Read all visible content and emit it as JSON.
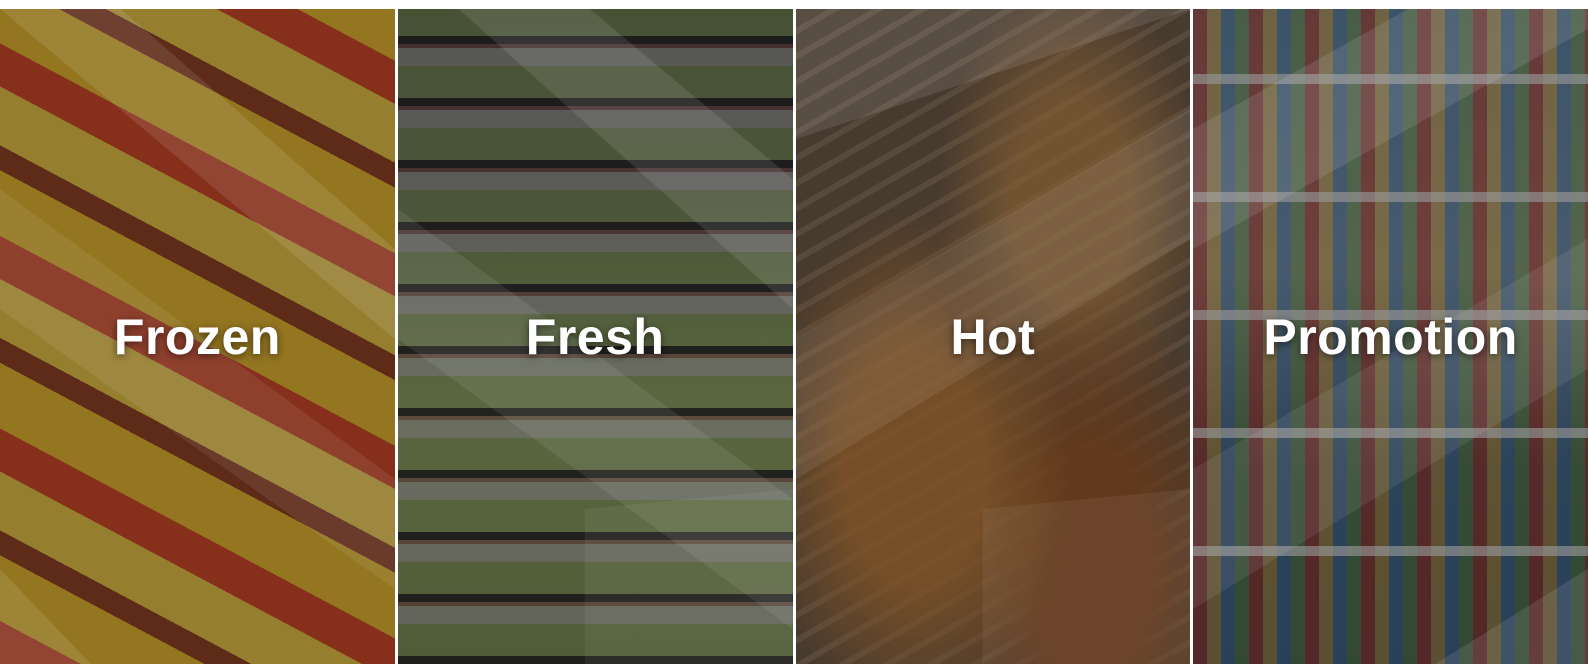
{
  "tiles": [
    {
      "id": "frozen",
      "label": "Frozen"
    },
    {
      "id": "fresh",
      "label": "Fresh"
    },
    {
      "id": "hot",
      "label": "Hot"
    },
    {
      "id": "promotion",
      "label": "Promotion"
    }
  ],
  "colors": {
    "label_text": "#ffffff",
    "divider": "#ffffff",
    "overlay": "#141414"
  }
}
